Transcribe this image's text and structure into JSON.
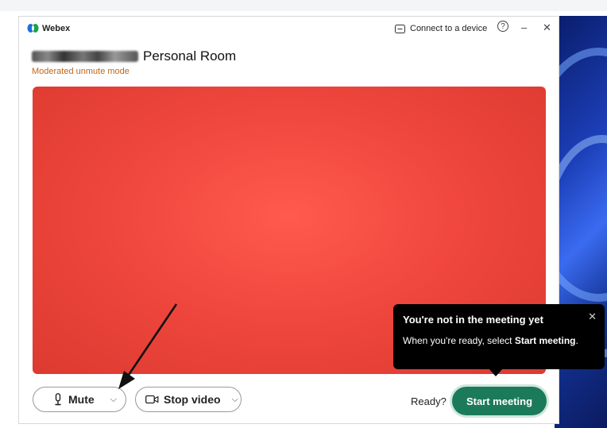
{
  "app": {
    "name": "Webex"
  },
  "titlebar": {
    "connect_label": "Connect to a device",
    "help_glyph": "?",
    "minimize_glyph": "–",
    "close_glyph": "✕"
  },
  "room": {
    "title_suffix": "Personal Room",
    "mode": "Moderated unmute mode"
  },
  "video": {
    "background_color": "#f0473e"
  },
  "controls": {
    "mute_label": "Mute",
    "stop_video_label": "Stop video",
    "ready_label": "Ready?",
    "start_label": "Start meeting"
  },
  "tooltip": {
    "title": "You're not in the meeting yet",
    "body_prefix": "When you're ready, select ",
    "body_bold": "Start meeting",
    "body_suffix": "."
  },
  "icons": [
    "webex-logo-icon",
    "connect-device-icon",
    "help-icon",
    "minimize-icon",
    "close-icon",
    "microphone-icon",
    "chevron-down-icon",
    "camera-icon",
    "tooltip-close-icon"
  ],
  "colors": {
    "accent_green": "#1b7a59",
    "mode_text": "#c0661a",
    "tooltip_bg": "#000000"
  }
}
